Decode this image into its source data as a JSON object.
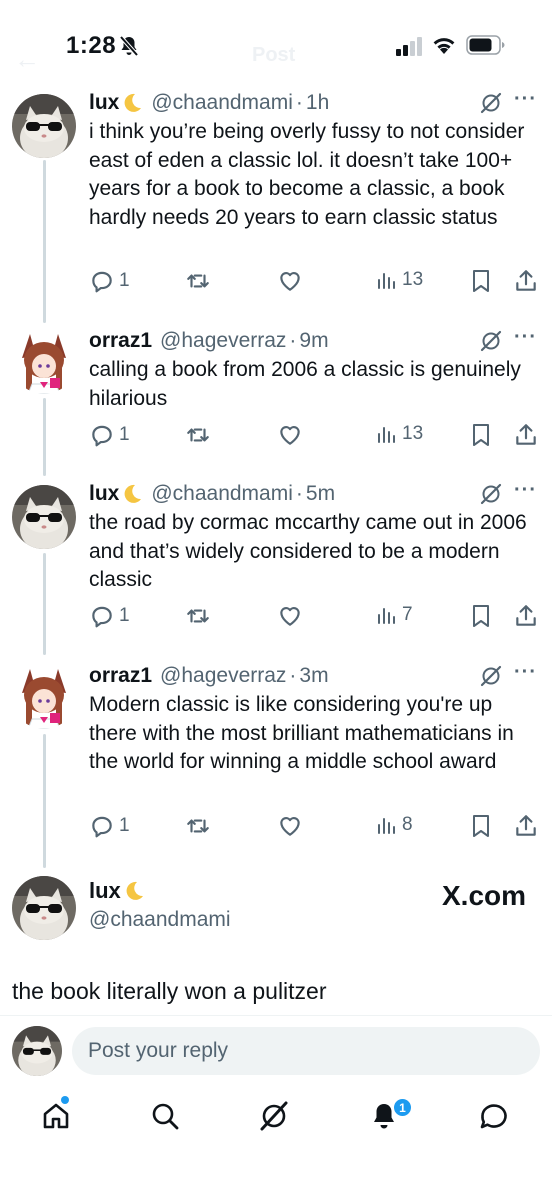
{
  "status_bar": {
    "time": "1:28"
  },
  "header": {
    "title": "Post"
  },
  "thread": [
    {
      "name": "lux",
      "has_moon": true,
      "handle": "@chaandmami",
      "time": "1h",
      "avatar": "cat-sunglasses",
      "text": "i think you’re being overly fussy to not consider east of eden a classic lol. it doesn’t take 100+ years for a book to become a classic, a book hardly needs 20 years to earn classic status",
      "replies": "1",
      "views": "13"
    },
    {
      "name": "orraz1",
      "has_moon": false,
      "handle": "@hageverraz",
      "time": "9m",
      "avatar": "anime-girl",
      "text": "calling a book from 2006 a classic is genuinely hilarious",
      "replies": "1",
      "views": "13"
    },
    {
      "name": "lux",
      "has_moon": true,
      "handle": "@chaandmami",
      "time": "5m",
      "avatar": "cat-sunglasses",
      "text": "the road by cormac mccarthy came out in 2006 and that’s widely considered to be a modern classic",
      "replies": "1",
      "views": "7"
    },
    {
      "name": "orraz1",
      "has_moon": false,
      "handle": "@hageverraz",
      "time": "3m",
      "avatar": "anime-girl",
      "text": "Modern classic is like considering you're up there with the most brilliant mathematicians in the world for winning a middle school award",
      "replies": "1",
      "views": "8"
    }
  ],
  "main_tweet": {
    "name": "lux",
    "handle": "@chaandmami",
    "watermark": "X.com",
    "text": "the book literally won a pulitzer"
  },
  "reply": {
    "placeholder": "Post your reply"
  },
  "nav": {
    "notifications_badge": "1",
    "items": [
      "home-icon",
      "search-icon",
      "grok-icon",
      "notifications-icon",
      "messages-icon"
    ]
  },
  "colors": {
    "text": "#0f1419",
    "secondary": "#536471",
    "accent": "#1d9bf0",
    "thread_line": "#cfd9de",
    "input_bg": "#eff3f4"
  }
}
